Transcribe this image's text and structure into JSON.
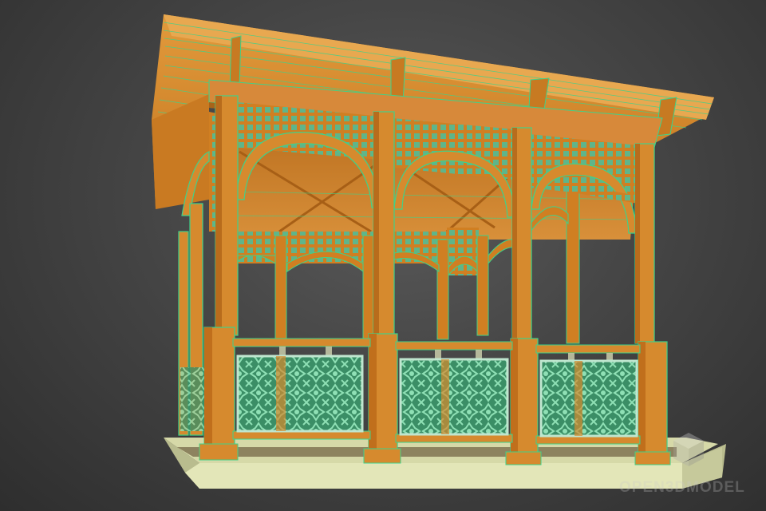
{
  "scene": {
    "subject": "gazebo-3d-model",
    "render_mode": "wireframe-on-shaded",
    "colors": {
      "wood": "#d68a2e",
      "wood_light": "#e4a04a",
      "wood_dark": "#a86418",
      "wire": "#3fd28a",
      "lattice": "#4aa37a",
      "panel": "#3e9c70",
      "base": "#e3e6b8",
      "base_side": "#b9bc8e",
      "background": "#444444"
    }
  },
  "watermark": {
    "text": "OPEN3DMODEL",
    "icon": "cube-logo-icon"
  }
}
